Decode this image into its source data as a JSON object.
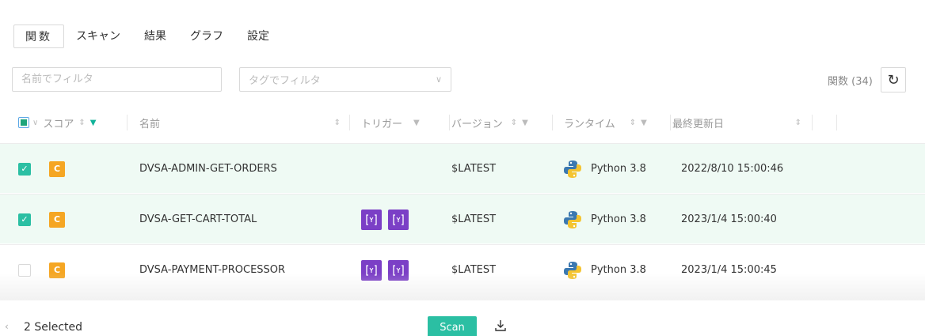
{
  "tabs": [
    {
      "label": "関数",
      "active": true
    },
    {
      "label": "スキャン"
    },
    {
      "label": "結果"
    },
    {
      "label": "グラフ"
    },
    {
      "label": "設定"
    }
  ],
  "filters": {
    "name_placeholder": "名前でフィルタ",
    "tag_placeholder": "タグでフィルタ"
  },
  "function_count": "関数 (34)",
  "columns": {
    "score": "スコア",
    "name": "名前",
    "trigger": "トリガー",
    "version": "バージョン",
    "runtime": "ランタイム",
    "updated": "最終更新日"
  },
  "rows": [
    {
      "selected": true,
      "score": "C",
      "name": "DVSA-ADMIN-GET-ORDERS",
      "triggers": 0,
      "version": "$LATEST",
      "runtime": "Python 3.8",
      "updated": "2022/8/10 15:00:46"
    },
    {
      "selected": true,
      "score": "C",
      "name": "DVSA-GET-CART-TOTAL",
      "triggers": 2,
      "version": "$LATEST",
      "runtime": "Python 3.8",
      "updated": "2023/1/4 15:00:40"
    },
    {
      "selected": false,
      "score": "C",
      "name": "DVSA-PAYMENT-PROCESSOR",
      "triggers": 2,
      "version": "$LATEST",
      "runtime": "Python 3.8",
      "updated": "2023/1/4 15:00:45"
    }
  ],
  "footer": {
    "selected_label": "2 Selected",
    "scan_label": "Scan"
  },
  "colors": {
    "accent": "#2bbfa3",
    "score_c": "#f5a623",
    "trigger": "#7b3fc6",
    "selected_row": "#effaf4"
  },
  "icons": {
    "trigger": "api-gateway-icon",
    "runtime": "python-icon",
    "refresh": "refresh-icon",
    "download": "download-icon"
  }
}
